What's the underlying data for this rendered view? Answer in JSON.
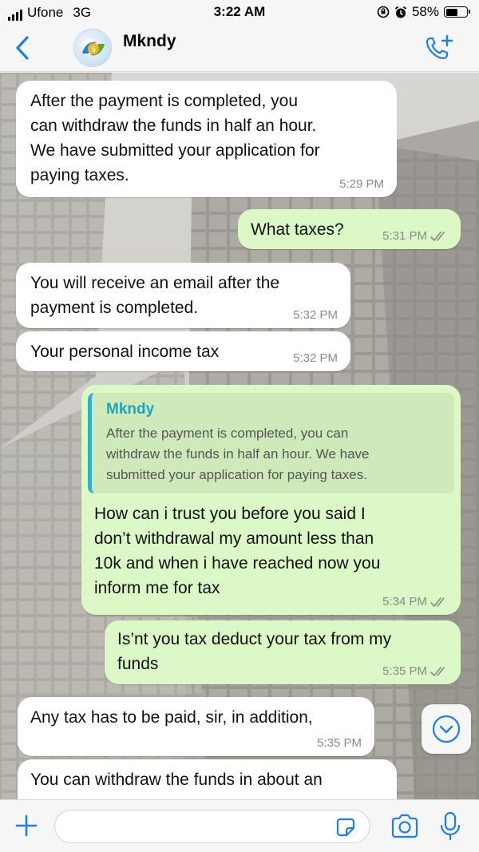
{
  "status_bar": {
    "carrier": "Ufone",
    "network": "3G",
    "time": "3:22 AM",
    "battery": "58%",
    "battery_level": 0.58
  },
  "header": {
    "contact_name": "Mkndy",
    "back_icon": "chevron-left-icon",
    "call_icon": "add-call-icon"
  },
  "messages": [
    {
      "direction": "incoming",
      "lines": [
        "After the payment is completed, you",
        "can withdraw the funds in half an hour.",
        "We have submitted your application for",
        "paying taxes."
      ],
      "time": "5:29 PM"
    },
    {
      "direction": "outgoing",
      "lines": [
        "What taxes?"
      ],
      "time": "5:31 PM"
    },
    {
      "direction": "incoming",
      "lines": [
        "You will receive an email after the",
        "payment is completed."
      ],
      "time": "5:32 PM"
    },
    {
      "direction": "incoming",
      "lines": [
        "Your personal income tax"
      ],
      "time": "5:32 PM"
    },
    {
      "direction": "outgoing",
      "quote": {
        "name": "Mkndy",
        "lines": [
          "After the payment is completed, you can",
          "withdraw the funds in half an hour. We have",
          "submitted your application for paying taxes."
        ]
      },
      "lines": [
        "How can i trust you before you said I",
        "don’t withdrawal my amount less than",
        "10k and when i have reached now you",
        "inform me for tax"
      ],
      "time": "5:34 PM"
    },
    {
      "direction": "outgoing",
      "lines": [
        "Is’nt you tax deduct your tax from my",
        "funds"
      ],
      "time": "5:35 PM"
    },
    {
      "direction": "incoming",
      "lines": [
        "Any tax has to be paid, sir, in addition,"
      ],
      "time": "5:35 PM"
    },
    {
      "direction": "incoming",
      "lines": [
        "You can withdraw the funds in about an"
      ],
      "time": ""
    }
  ],
  "input_bar": {
    "placeholder": "",
    "icons": [
      "plus-icon",
      "sticker-icon",
      "camera-icon",
      "microphone-icon"
    ]
  },
  "colors": {
    "incoming_bubble": "#ffffff",
    "outgoing_bubble": "#dcf8c6",
    "accent": "#1f7ee0",
    "quote_bar": "#31b0c7",
    "read_ticks": "#8a8a8a"
  }
}
